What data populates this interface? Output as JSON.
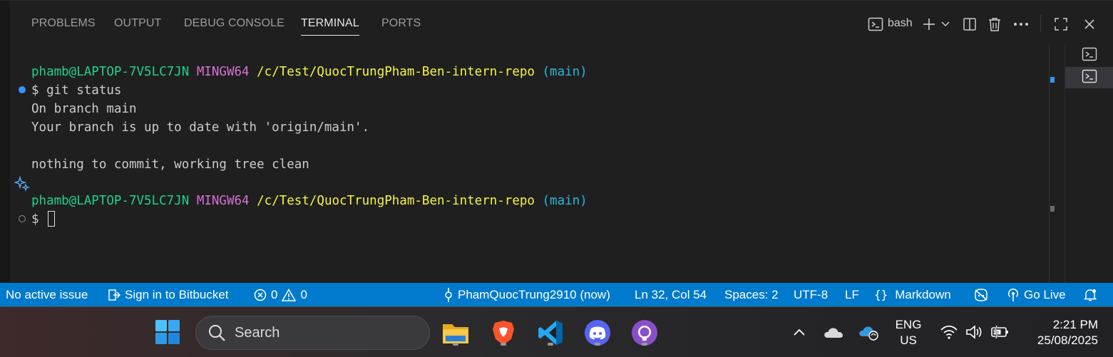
{
  "panel": {
    "tabs": [
      {
        "label": "PROBLEMS"
      },
      {
        "label": "OUTPUT"
      },
      {
        "label": "DEBUG CONSOLE"
      },
      {
        "label": "TERMINAL",
        "active": true
      },
      {
        "label": "PORTS"
      }
    ],
    "toolbar": {
      "shell_label": "bash",
      "icons": [
        "terminal-icon",
        "plus-icon",
        "chevron-down-icon",
        "split-icon",
        "trash-icon",
        "ellipsis-icon",
        "maximize-icon",
        "close-icon"
      ]
    }
  },
  "terminal": {
    "prompt1": {
      "user": "phamb@LAPTOP-7V5LC7JN",
      "env": "MINGW64",
      "path": "/c/Test/QuocTrungPham-Ben-intern-repo",
      "branch": "(main)"
    },
    "command": "$ git status",
    "output": [
      "On branch main",
      "Your branch is up to date with 'origin/main'.",
      "",
      "nothing to commit, working tree clean"
    ],
    "prompt2": {
      "user": "phamb@LAPTOP-7V5LC7JN",
      "env": "MINGW64",
      "path": "/c/Test/QuocTrungPham-Ben-intern-repo",
      "branch": "(main)"
    },
    "input_prompt": "$",
    "colors": {
      "user": "#23d18b",
      "env": "#d670d6",
      "path": "#f5f543",
      "branch": "#29b8db"
    }
  },
  "statusbar": {
    "issue": "No active issue",
    "bitbucket": "Sign in to Bitbucket",
    "errors": "0",
    "warnings": "0",
    "author": "PhamQuocTrung2910 (now)",
    "position": "Ln 32, Col 54",
    "spaces": "Spaces: 2",
    "encoding": "UTF-8",
    "eol": "LF",
    "language": "Markdown",
    "golive": "Go Live",
    "color": "#007acc"
  },
  "taskbar": {
    "search_placeholder": "Search",
    "apps": [
      "file-explorer-icon",
      "brave-icon",
      "vscode-icon",
      "discord-icon",
      "github-desktop-icon"
    ],
    "lang_line1": "ENG",
    "lang_line2": "US",
    "time": "2:21 PM",
    "date": "25/08/2025"
  }
}
